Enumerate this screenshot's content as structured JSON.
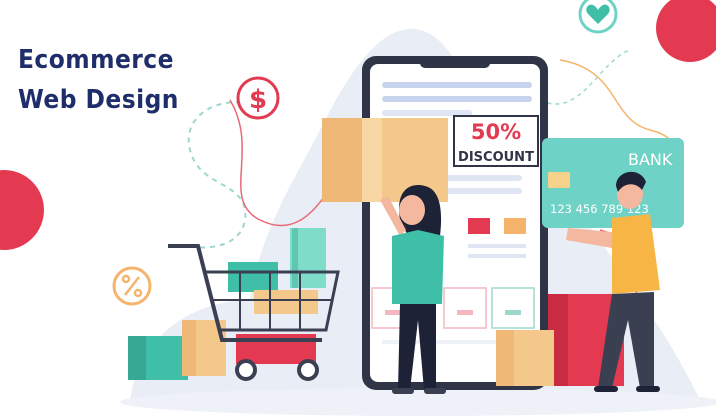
{
  "headline": {
    "line1": "Ecommerce",
    "line2": "Web Design"
  },
  "discount_sign": {
    "percent": "50%",
    "label": "DISCOUNT"
  },
  "bank_card": {
    "bank_label": "BANK",
    "number": "123 456 789 123"
  },
  "icons": {
    "dollar": "dollar-coin-icon",
    "percent": "percent-badge-icon",
    "heart": "heart-bubble-icon"
  },
  "colors": {
    "title": "#1f2e6b",
    "accent_red": "#e33a52",
    "teal": "#6ed3c6",
    "box": "#f4c88a",
    "shirt": "#3fbfa8",
    "orange_shirt": "#f6b545"
  }
}
